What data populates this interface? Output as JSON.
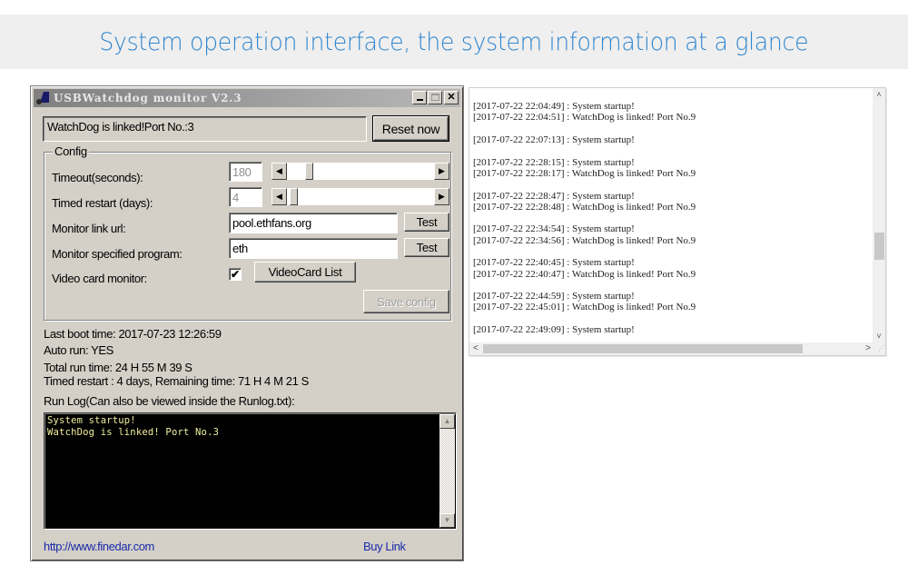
{
  "banner": {
    "title": "System operation interface, the system information at a glance",
    "color": "#2f86cf"
  },
  "window": {
    "title": "USBWatchdog monitor V2.3",
    "icon": "watchdog-app-icon",
    "controls": {
      "minimize": "minimize-icon",
      "maximize": "maximize-icon",
      "close": "close-icon",
      "close_glyph": "✕"
    },
    "status_text": "WatchDog is linked!Port No.:3",
    "reset_button": "Reset now",
    "config": {
      "legend": "Config",
      "timeout": {
        "label": "Timeout(seconds):",
        "value": "180",
        "slider_position_fraction": 0.13
      },
      "timed_restart": {
        "label": "Timed restart (days):",
        "value": "4",
        "slider_position_fraction": 0.02
      },
      "monitor_url": {
        "label": "Monitor link url:",
        "value": "pool.ethfans.org",
        "test_button": "Test"
      },
      "monitor_program": {
        "label": "Monitor specified program:",
        "value": "eth",
        "test_button": "Test"
      },
      "video_card": {
        "label": "Video card monitor:",
        "checked": true,
        "check_glyph": "✔",
        "list_button": "VideoCard List"
      },
      "save_button": "Save config"
    },
    "info": {
      "last_boot": "Last boot time: 2017-07-23 12:26:59",
      "auto_run": "Auto run: YES",
      "total_run": "Total run time: 24 H 55 M 39 S",
      "timed_restart": "Timed restart : 4 days,  Remaining time: 71 H 4 M 21 S",
      "run_log_label": "Run Log(Can also be viewed inside the Runlog.txt):"
    },
    "console": {
      "text": "System startup!\nWatchDog is linked! Port No.3",
      "text_color": "#f0f0a0",
      "scroll_up_glyph": "▲",
      "scroll_down_glyph": "▼"
    },
    "footer": {
      "website_link": "http://www.finedar.com",
      "buy_link": "Buy Link"
    }
  },
  "log_panel": {
    "entries": [
      [
        "[2017-07-22 22:04:49] : System startup!",
        "[2017-07-22 22:04:51] : WatchDog is linked! Port No.9"
      ],
      [
        "[2017-07-22 22:07:13] : System startup!"
      ],
      [
        "[2017-07-22 22:28:15] : System startup!",
        "[2017-07-22 22:28:17] : WatchDog is linked! Port No.9"
      ],
      [
        "[2017-07-22 22:28:47] : System startup!",
        "[2017-07-22 22:28:48] : WatchDog is linked! Port No.9"
      ],
      [
        "[2017-07-22 22:34:54] : System startup!",
        "[2017-07-22 22:34:56] : WatchDog is linked! Port No.9"
      ],
      [
        "[2017-07-22 22:40:45] : System startup!",
        "[2017-07-22 22:40:47] : WatchDog is linked! Port No.9"
      ],
      [
        "[2017-07-22 22:44:59] : System startup!",
        "[2017-07-22 22:45:01] : WatchDog is linked! Port No.9"
      ],
      [
        "[2017-07-22 22:49:09] : System startup!"
      ]
    ],
    "scroll_glyphs": {
      "up": "˄",
      "down": "˅",
      "left": "<",
      "right": ">"
    }
  }
}
